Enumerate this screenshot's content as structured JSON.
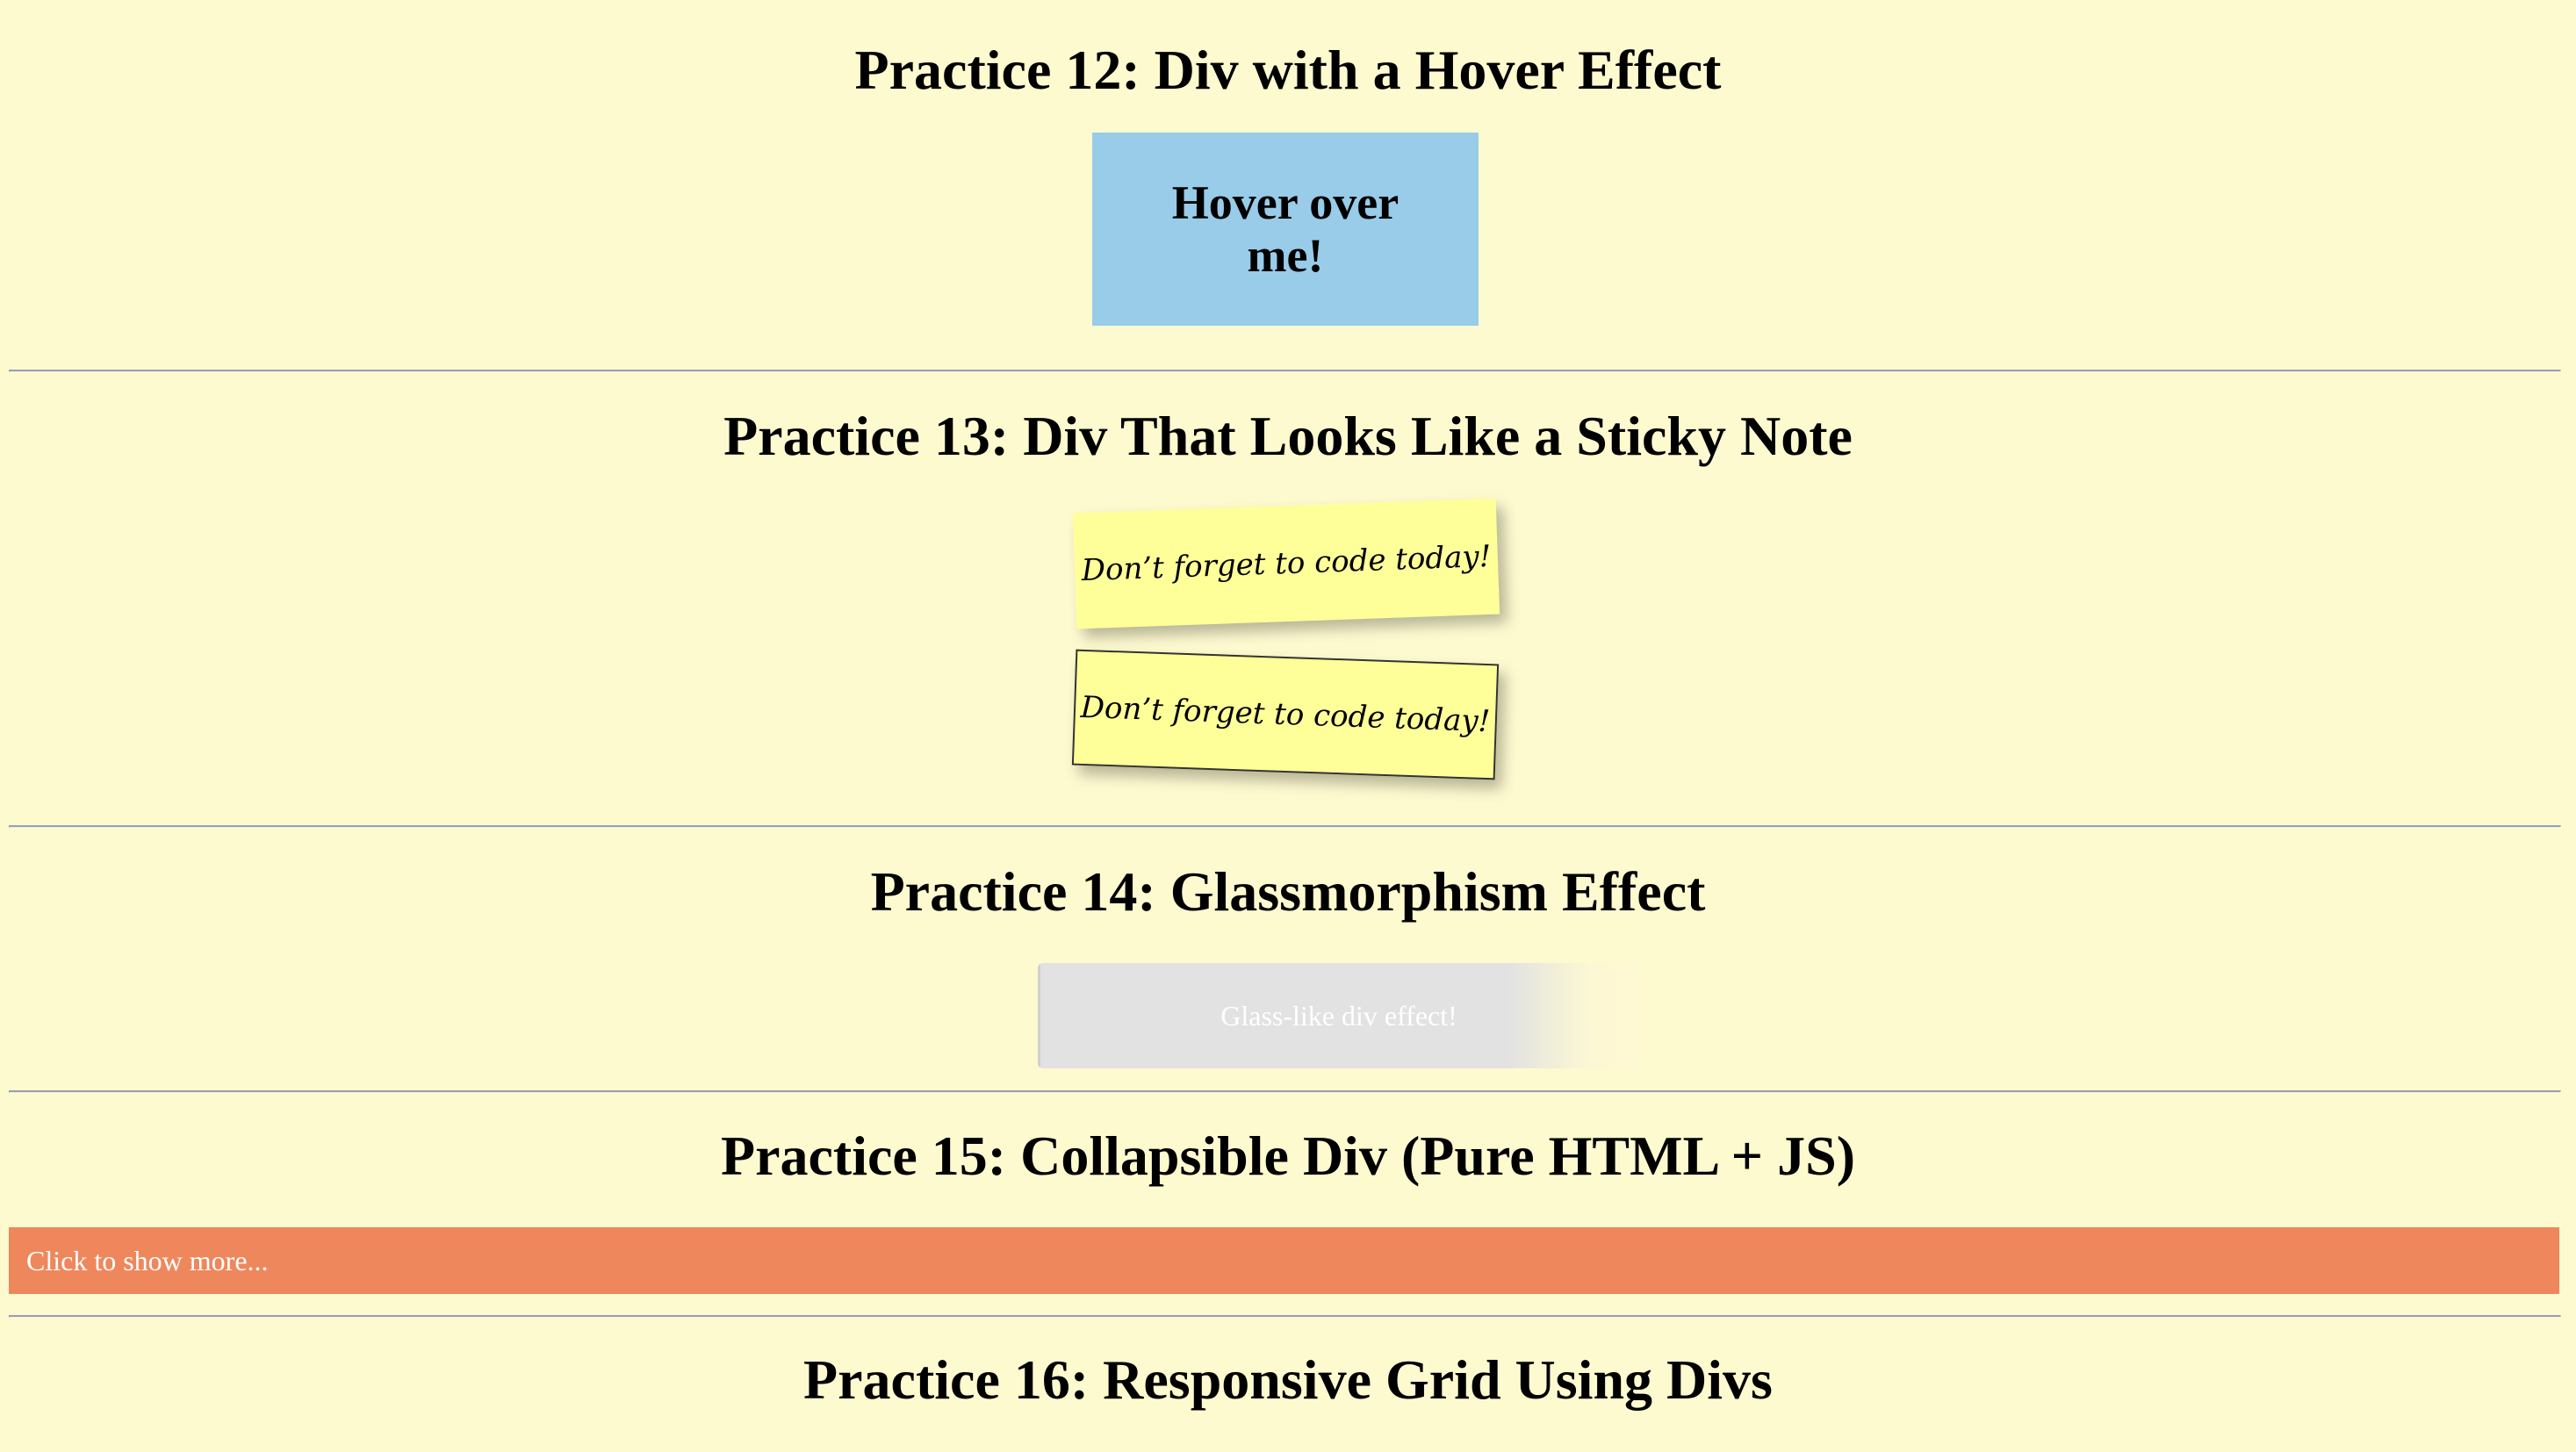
{
  "practice12": {
    "heading": "Practice 12: Div with a Hover Effect",
    "box_text": "Hover over me!",
    "box_color": "#98cce8"
  },
  "practice13": {
    "heading": "Practice 13: Div That Looks Like a Sticky Note",
    "notes": [
      {
        "text": "Don’t forget to code today!"
      },
      {
        "text": "Don’t forget to code today!"
      }
    ],
    "note_color": "#ffff99"
  },
  "practice14": {
    "heading": "Practice 14: Glassmorphism Effect",
    "glass_text": "Glass-like div effect!"
  },
  "practice15": {
    "heading": "Practice 15: Collapsible Div (Pure HTML + JS)",
    "toggle_label": "Click to show more...",
    "toggle_color": "#ef875d"
  },
  "practice16": {
    "heading": "Practice 16: Responsive Grid Using Divs"
  },
  "colors": {
    "background": "#fefad0",
    "divider": "#9aa0a8"
  }
}
